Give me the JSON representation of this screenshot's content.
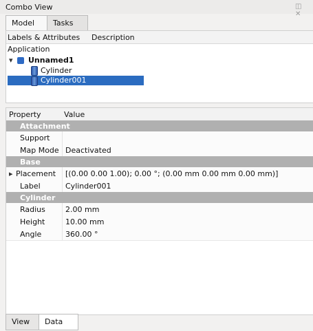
{
  "window": {
    "title": "Combo View",
    "title_buttons": [
      "◫",
      "✕"
    ]
  },
  "top_tabs": [
    {
      "label": "Model",
      "active": true
    },
    {
      "label": "Tasks",
      "active": false
    }
  ],
  "tree": {
    "headers": {
      "labels": "Labels & Attributes",
      "description": "Description"
    },
    "application": "Application",
    "root": {
      "name": "Unnamed1"
    },
    "children": [
      {
        "name": "Cylinder",
        "selected": false
      },
      {
        "name": "Cylinder001",
        "selected": true
      }
    ]
  },
  "property_panel": {
    "headers": {
      "property": "Property",
      "value": "Value"
    },
    "groups": [
      {
        "title": "Attachment",
        "rows": [
          {
            "name": "Support",
            "value": ""
          },
          {
            "name": "Map Mode",
            "value": "Deactivated"
          }
        ]
      },
      {
        "title": "Base",
        "rows": [
          {
            "name": "Placement",
            "value": "[(0.00 0.00 1.00); 0.00 °; (0.00 mm 0.00 mm 0.00 mm)]",
            "expandable": true
          },
          {
            "name": "Label",
            "value": "Cylinder001"
          }
        ]
      },
      {
        "title": "Cylinder",
        "rows": [
          {
            "name": "Radius",
            "value": "2.00 mm"
          },
          {
            "name": "Height",
            "value": "10.00 mm"
          },
          {
            "name": "Angle",
            "value": "360.00 °"
          }
        ]
      }
    ]
  },
  "bottom_tabs": [
    {
      "label": "View",
      "active": false
    },
    {
      "label": "Data",
      "active": true
    }
  ],
  "colors": {
    "selection": "#2b6cc0",
    "group_header": "#b0b0b0"
  }
}
